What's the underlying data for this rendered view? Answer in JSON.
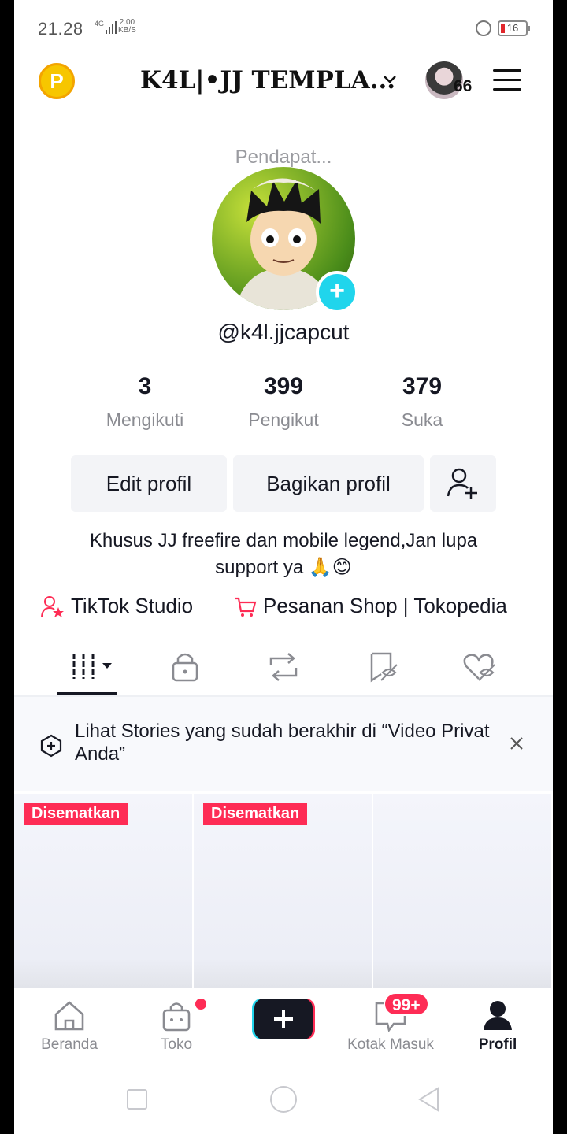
{
  "status_bar": {
    "time": "21.28",
    "network": "4G",
    "speed_value": "2.00",
    "speed_unit": "KB/S",
    "battery": "16"
  },
  "header": {
    "coin_label": "P",
    "title": "K4L|•JJ TEMPLA...",
    "story_count": "66"
  },
  "profile": {
    "pending_label": "Pendapat...",
    "handle": "@k4l.jjcapcut",
    "stats": [
      {
        "value": "3",
        "label": "Mengikuti"
      },
      {
        "value": "399",
        "label": "Pengikut"
      },
      {
        "value": "379",
        "label": "Suka"
      }
    ],
    "buttons": {
      "edit": "Edit profil",
      "share": "Bagikan profil"
    },
    "bio": "Khusus JJ freefire dan mobile legend,Jan lupa support ya 🙏😊",
    "links": {
      "studio": "TikTok Studio",
      "shop": "Pesanan Shop | Tokopedia"
    }
  },
  "tabs": [
    "videos-grid-icon",
    "lock-icon",
    "repost-icon",
    "favorites-icon",
    "liked-icon"
  ],
  "banner": {
    "text": "Lihat Stories yang sudah berakhir di “Video Privat Anda”"
  },
  "videos": [
    {
      "pinned_label": "Disematkan"
    },
    {
      "pinned_label": "Disematkan"
    },
    {
      "pinned_label": ""
    }
  ],
  "bottom_nav": {
    "items": [
      {
        "label": "Beranda"
      },
      {
        "label": "Toko"
      },
      {
        "label": ""
      },
      {
        "label": "Kotak Masuk"
      },
      {
        "label": "Profil"
      }
    ],
    "inbox_badge": "99+"
  },
  "colors": {
    "accent_red": "#fe2c55",
    "accent_cyan": "#20d5ec",
    "text": "#161823",
    "muted": "#8a8b91"
  }
}
